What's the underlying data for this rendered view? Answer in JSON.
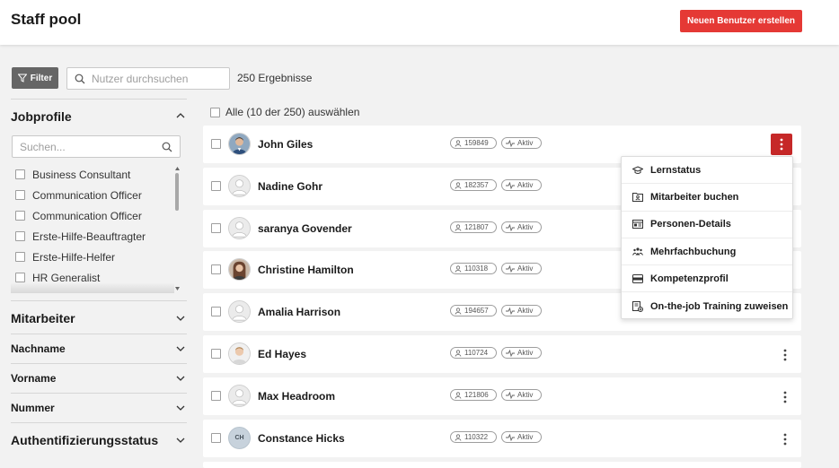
{
  "header": {
    "title": "Staff pool",
    "new_user_label": "Neuen Benutzer erstellen"
  },
  "toolbar": {
    "filter_label": "Filter",
    "search_placeholder": "Nutzer durchsuchen",
    "results": "250 Ergebnisse"
  },
  "sidebar": {
    "jobprofile_title": "Jobprofile",
    "jobprofile_search_placeholder": "Suchen...",
    "jobprofiles": [
      "Business Consultant",
      "Communication Officer",
      "Communication Officer",
      "Erste-Hilfe-Beauftragter",
      "Erste-Hilfe-Helfer",
      "HR Generalist"
    ],
    "mitarbeiter_title": "Mitarbeiter",
    "nachname_title": "Nachname",
    "vorname_title": "Vorname",
    "nummer_title": "Nummer",
    "auth_title": "Authentifizierungsstatus"
  },
  "list": {
    "select_all": "Alle (10 der 250) auswählen",
    "rows": [
      {
        "name": "John Giles",
        "id": "159849",
        "status": "Aktiv"
      },
      {
        "name": "Nadine Gohr",
        "id": "182357",
        "status": "Aktiv"
      },
      {
        "name": "saranya Govender",
        "id": "121807",
        "status": "Aktiv"
      },
      {
        "name": "Christine Hamilton",
        "id": "110318",
        "status": "Aktiv"
      },
      {
        "name": "Amalia Harrison",
        "id": "194657",
        "status": "Aktiv"
      },
      {
        "name": "Ed Hayes",
        "id": "110724",
        "status": "Aktiv"
      },
      {
        "name": "Max Headroom",
        "id": "121806",
        "status": "Aktiv"
      },
      {
        "name": "Constance Hicks",
        "id": "110322",
        "status": "Aktiv",
        "initials": "CH"
      }
    ]
  },
  "menu": {
    "items": [
      "Lernstatus",
      "Mitarbeiter buchen",
      "Personen-Details",
      "Mehrfachbuchung",
      "Kompetenzprofil",
      "On-the-job Training zuweisen"
    ]
  },
  "colors": {
    "accent": "#e53935",
    "kebab_active": "#c62828",
    "filter_bg": "#666666"
  }
}
